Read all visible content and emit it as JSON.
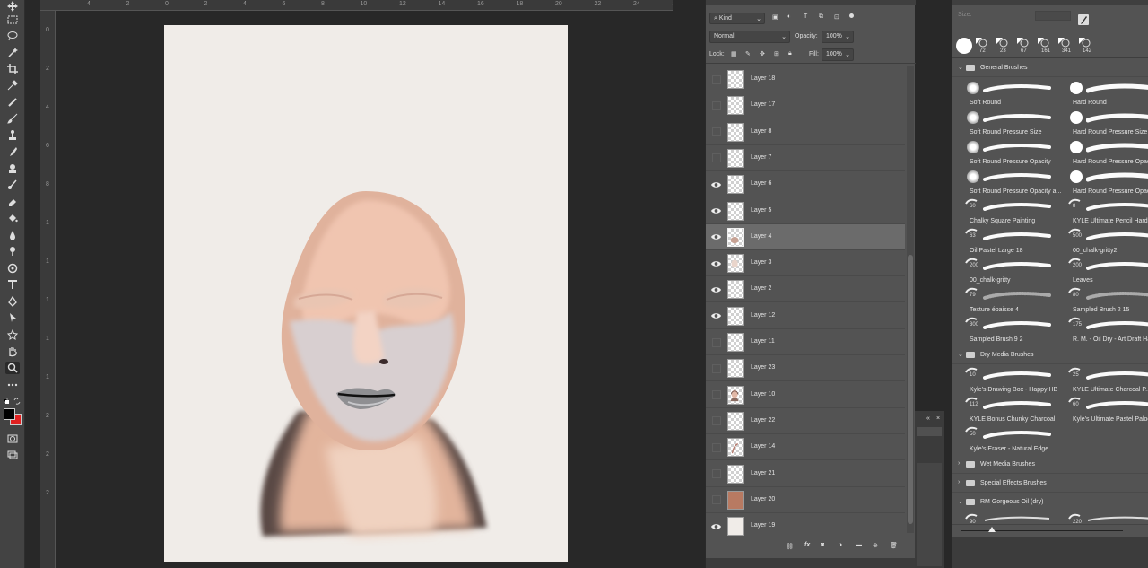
{
  "ruler": {
    "top_ticks": [
      "4",
      "2",
      "0",
      "2",
      "4",
      "6",
      "8",
      "10",
      "12",
      "14",
      "16",
      "18",
      "20",
      "22",
      "24",
      "26"
    ],
    "left_ticks": [
      "0",
      "2",
      "4",
      "6",
      "8",
      "1",
      "1",
      "1",
      "1",
      "1",
      "2",
      "2",
      "2"
    ]
  },
  "layers_panel": {
    "filter_kind": "Kind",
    "blend_mode": "Normal",
    "opacity_label": "Opacity:",
    "opacity_value": "100%",
    "lock_label": "Lock:",
    "fill_label": "Fill:",
    "fill_value": "100%",
    "layers": [
      {
        "name": "Layer 18",
        "visible": false,
        "thumb": "empty"
      },
      {
        "name": "Layer 17",
        "visible": false,
        "thumb": "empty"
      },
      {
        "name": "Layer 8",
        "visible": false,
        "thumb": "empty"
      },
      {
        "name": "Layer 7",
        "visible": false,
        "thumb": "empty"
      },
      {
        "name": "Layer 6",
        "visible": true,
        "thumb": "empty"
      },
      {
        "name": "Layer 5",
        "visible": true,
        "thumb": "empty"
      },
      {
        "name": "Layer 4",
        "visible": true,
        "thumb": "face",
        "selected": true
      },
      {
        "name": "Layer 3",
        "visible": true,
        "thumb": "face-light"
      },
      {
        "name": "Layer 2",
        "visible": true,
        "thumb": "empty"
      },
      {
        "name": "Layer 12",
        "visible": true,
        "thumb": "empty"
      },
      {
        "name": "Layer 11",
        "visible": false,
        "thumb": "empty"
      },
      {
        "name": "Layer 23",
        "visible": false,
        "thumb": "empty"
      },
      {
        "name": "Layer 10",
        "visible": false,
        "thumb": "portrait"
      },
      {
        "name": "Layer 22",
        "visible": false,
        "thumb": "empty"
      },
      {
        "name": "Layer 14",
        "visible": false,
        "thumb": "mark"
      },
      {
        "name": "Layer 21",
        "visible": false,
        "thumb": "empty"
      },
      {
        "name": "Layer 20",
        "visible": false,
        "thumb": "solid",
        "color": "#b87a62"
      },
      {
        "name": "Layer 19",
        "visible": true,
        "thumb": "solid",
        "color": "#f0ece8"
      }
    ]
  },
  "brushes_panel": {
    "size_label": "Size:",
    "preset_sizes": [
      "72",
      "23",
      "67",
      "161",
      "341",
      "142"
    ],
    "groups": [
      {
        "name": "General Brushes",
        "expanded": true
      },
      {
        "name": "Dry Media Brushes",
        "expanded": true
      },
      {
        "name": "Wet Media Brushes",
        "expanded": false
      },
      {
        "name": "Special Effects Brushes",
        "expanded": false
      },
      {
        "name": "RM Gorgeous Oil (dry)",
        "expanded": true
      }
    ],
    "general": [
      {
        "name": "Soft Round",
        "size": "",
        "kind": "soft"
      },
      {
        "name": "Hard Round",
        "size": "",
        "kind": "hard"
      },
      {
        "name": "Soft Round Pressure Size",
        "size": "",
        "kind": "soft"
      },
      {
        "name": "Hard Round Pressure Size",
        "size": "",
        "kind": "hard"
      },
      {
        "name": "Soft Round Pressure Opacity",
        "size": "",
        "kind": "soft"
      },
      {
        "name": "Hard Round Pressure Opacity",
        "size": "",
        "kind": "hard"
      },
      {
        "name": "Soft Round Pressure Opacity a...",
        "size": "",
        "kind": "soft"
      },
      {
        "name": "Hard Round Pressure Opacity...",
        "size": "",
        "kind": "hard"
      },
      {
        "name": "Chalky Square Painting",
        "size": "60",
        "kind": "tip"
      },
      {
        "name": "KYLE Ultimate Pencil Hard",
        "size": "8",
        "kind": "tip"
      },
      {
        "name": "Oil Pastel Large 18",
        "size": "63",
        "kind": "tip"
      },
      {
        "name": "00_chalk-gritty2",
        "size": "500",
        "kind": "tip"
      },
      {
        "name": "00_chalk-gritty",
        "size": "200",
        "kind": "tip"
      },
      {
        "name": "Leaves",
        "size": "200",
        "kind": "tip"
      },
      {
        "name": "Texture épaisse 4",
        "size": "79",
        "kind": "texture"
      },
      {
        "name": "Sampled Brush 2 15",
        "size": "80",
        "kind": "texture"
      },
      {
        "name": "Sampled Brush 9 2",
        "size": "300",
        "kind": "tip"
      },
      {
        "name": "R. M. - Oil Dry - Art Draft Half...",
        "size": "175",
        "kind": "tip"
      }
    ],
    "dry_media": [
      {
        "name": "Kyle's Drawing Box - Happy HB",
        "size": "10"
      },
      {
        "name": "KYLE Ultimate Charcoal P...",
        "size": "25"
      },
      {
        "name": "KYLE Bonus Chunky Charcoal",
        "size": "112"
      },
      {
        "name": "Kyle's Ultimate Pastel Palooza",
        "size": "60"
      },
      {
        "name": "Kyle's Eraser - Natural Edge",
        "size": "50"
      }
    ],
    "rm_oil_sizes": [
      "90",
      "220"
    ]
  },
  "colors": {
    "foreground": "#000000",
    "background": "#e02020",
    "accent_selected_layer": "#6b6b6b",
    "canvas": "#f0ece8",
    "skin": "#e3b8a3"
  }
}
